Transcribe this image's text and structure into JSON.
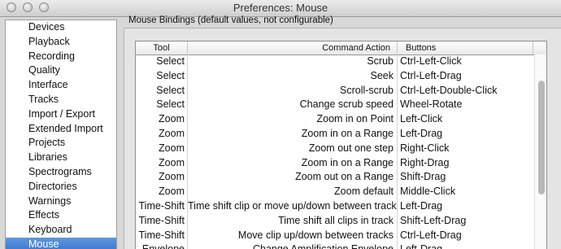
{
  "window": {
    "title": "Preferences: Mouse"
  },
  "sidebar": {
    "items": [
      {
        "label": "Devices"
      },
      {
        "label": "Playback"
      },
      {
        "label": "Recording"
      },
      {
        "label": "Quality"
      },
      {
        "label": "Interface"
      },
      {
        "label": "Tracks"
      },
      {
        "label": "Import / Export"
      },
      {
        "label": "Extended Import"
      },
      {
        "label": "Projects"
      },
      {
        "label": "Libraries"
      },
      {
        "label": "Spectrograms"
      },
      {
        "label": "Directories"
      },
      {
        "label": "Warnings"
      },
      {
        "label": "Effects"
      },
      {
        "label": "Keyboard"
      },
      {
        "label": "Mouse",
        "selected": true
      }
    ]
  },
  "main": {
    "section_label": "Mouse Bindings (default values, not configurable)",
    "table": {
      "headers": {
        "tool": "Tool",
        "command": "Command Action",
        "buttons": "Buttons"
      },
      "rows": [
        {
          "tool": "Select",
          "command": "Scrub",
          "buttons": "Ctrl-Left-Click"
        },
        {
          "tool": "Select",
          "command": "Seek",
          "buttons": "Ctrl-Left-Drag"
        },
        {
          "tool": "Select",
          "command": "Scroll-scrub",
          "buttons": "Ctrl-Left-Double-Click"
        },
        {
          "tool": "Select",
          "command": "Change scrub speed",
          "buttons": "Wheel-Rotate"
        },
        {
          "tool": "Zoom",
          "command": "Zoom in on Point",
          "buttons": "Left-Click"
        },
        {
          "tool": "Zoom",
          "command": "Zoom in on a Range",
          "buttons": "Left-Drag"
        },
        {
          "tool": "Zoom",
          "command": "Zoom out one step",
          "buttons": "Right-Click"
        },
        {
          "tool": "Zoom",
          "command": "Zoom in on a Range",
          "buttons": "Right-Drag"
        },
        {
          "tool": "Zoom",
          "command": "Zoom out on a Range",
          "buttons": "Shift-Drag"
        },
        {
          "tool": "Zoom",
          "command": "Zoom default",
          "buttons": "Middle-Click"
        },
        {
          "tool": "Time-Shift",
          "command": "Time shift clip or move up/down between tracks",
          "buttons": "Left-Drag"
        },
        {
          "tool": "Time-Shift",
          "command": "Time shift all clips in track",
          "buttons": "Shift-Left-Drag"
        },
        {
          "tool": "Time-Shift",
          "command": "Move clip up/down between tracks",
          "buttons": "Ctrl-Left-Drag"
        },
        {
          "tool": "Envelope",
          "command": "Change Amplification Envelope",
          "buttons": "Left-Drag"
        }
      ]
    }
  }
}
